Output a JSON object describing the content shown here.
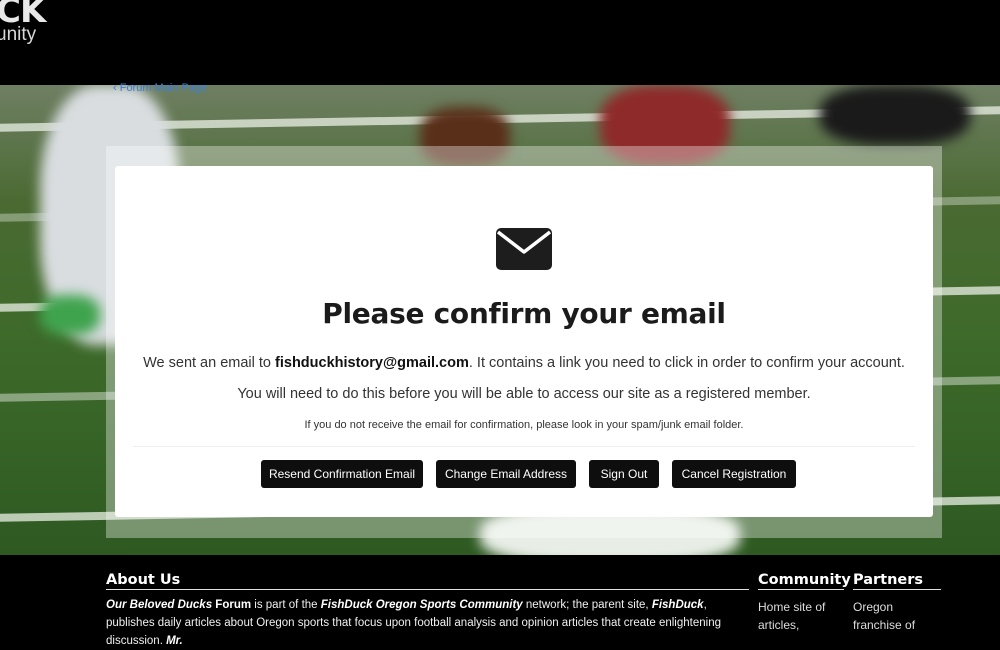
{
  "header": {
    "logo_text_top": "CK",
    "logo_text_bottom": "unity"
  },
  "breadcrumb": {
    "label": "‹ Forum Main Page"
  },
  "confirm_card": {
    "icon": "envelope-icon",
    "title": "Please confirm your email",
    "line1_prefix": "We sent an email to ",
    "email": "fishduckhistory@gmail.com",
    "line1_suffix": ". It contains a link you need to click in order to confirm your account.",
    "line2": "You will need to do this before you will be able to access our site as a registered member.",
    "line3": "If you do not receive the email for confirmation, please look in your spam/junk email folder.",
    "buttons": {
      "resend": "Resend Confirmation Email",
      "change_email": "Change Email Address",
      "sign_out": "Sign Out",
      "cancel": "Cancel Registration"
    }
  },
  "footer": {
    "about": {
      "heading": "About Us",
      "forum_name": "Our Beloved Ducks",
      "forum_suffix": " Forum",
      "text_a": " is part of the ",
      "network_name": "FishDuck Oregon Sports Community",
      "text_b": " network; the parent site, ",
      "site_name": "FishDuck",
      "text_c": ", publishes daily articles about Oregon sports that focus upon football analysis and opinion articles that create enlightening discussion. ",
      "mr": "Mr."
    },
    "community": {
      "heading": "Community",
      "text": "Home site of articles,"
    },
    "partners": {
      "heading": "Partners",
      "text": "Oregon franchise of"
    }
  },
  "colors": {
    "button_bg": "#0e0e0e",
    "link": "#3a7fd8",
    "footer_bg": "#000000"
  }
}
